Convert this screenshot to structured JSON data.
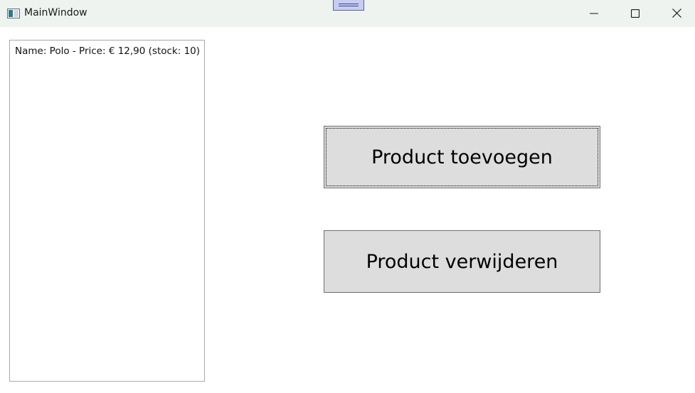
{
  "window": {
    "title": "MainWindow"
  },
  "titlebar": {
    "app_icon": "window-icon",
    "minimize_icon": "minimize-icon",
    "maximize_icon": "maximize-icon",
    "close_icon": "close-icon",
    "grip_icon": "drag-grip-icon"
  },
  "product_list": {
    "items": [
      "Name: Polo - Price: € 12,90 (stock: 10)"
    ]
  },
  "buttons": {
    "add_label": "Product toevoegen",
    "remove_label": "Product verwijderen"
  },
  "colors": {
    "titlebar_bg": "#eef3ef",
    "button_bg": "#dddddd",
    "button_border": "#707070",
    "list_border": "#a9a9a9"
  }
}
